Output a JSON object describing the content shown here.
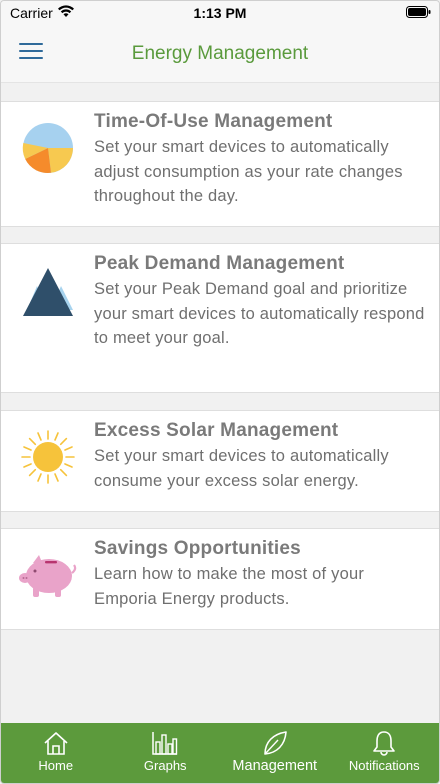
{
  "status_bar": {
    "carrier": "Carrier",
    "time": "1:13 PM"
  },
  "header": {
    "title": "Energy Management",
    "menu_icon": "hamburger-menu-icon"
  },
  "cards": [
    {
      "title": "Time-Of-Use Management",
      "description": "Set your smart devices to automatically adjust consumption as your rate changes throughout the day.",
      "icon": "pie-chart-icon"
    },
    {
      "title": "Peak Demand Management",
      "description": "Set your Peak Demand goal and prioritize your smart devices to automatically respond to meet your goal.",
      "icon": "mountain-peak-icon"
    },
    {
      "title": "Excess Solar Management",
      "description": "Set your smart devices to automatically consume your excess solar energy.",
      "icon": "sun-icon"
    },
    {
      "title": "Savings Opportunities",
      "description": "Learn how to make the most of your Emporia Energy products.",
      "icon": "piggy-bank-icon"
    }
  ],
  "tabs": [
    {
      "label": "Home",
      "icon": "home-icon",
      "active": false
    },
    {
      "label": "Graphs",
      "icon": "bar-graph-icon",
      "active": false
    },
    {
      "label": "Management",
      "icon": "leaf-icon",
      "active": true
    },
    {
      "label": "Notifications",
      "icon": "bell-icon",
      "active": false
    }
  ],
  "colors": {
    "accent_green": "#5c9a3c",
    "title_green": "#5a9a3c",
    "menu_blue": "#2f6a9a",
    "peak_dark": "#2f4f6a",
    "peak_light": "#a7d3ee",
    "sun_yellow": "#f6c33b",
    "piggy_pink": "#e9a3c9"
  }
}
